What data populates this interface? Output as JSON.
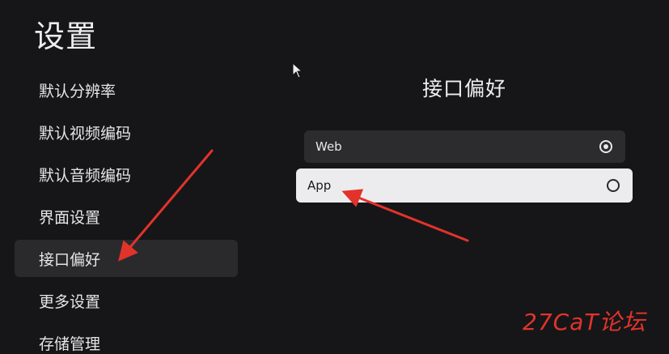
{
  "page": {
    "title": "设置"
  },
  "sidebar": {
    "items": [
      {
        "label": "默认分辨率"
      },
      {
        "label": "默认视频编码"
      },
      {
        "label": "默认音频编码"
      },
      {
        "label": "界面设置"
      },
      {
        "label": "接口偏好",
        "selected": true
      },
      {
        "label": "更多设置"
      },
      {
        "label": "存储管理"
      }
    ]
  },
  "panel": {
    "title": "接口偏好",
    "options": [
      {
        "label": "Web",
        "checked": true,
        "focused": false
      },
      {
        "label": "App",
        "checked": false,
        "focused": true
      }
    ]
  },
  "colors": {
    "background": "#161618",
    "selected_item": "#2a2a2d",
    "focused_option": "#ececee",
    "annotation_arrow": "#e2332b"
  },
  "watermark": {
    "text": "27CaT论坛"
  },
  "icons": {
    "cursor": "mouse-pointer-icon",
    "radio_checked": "radio-checked-icon",
    "radio_unchecked": "radio-unchecked-icon"
  }
}
